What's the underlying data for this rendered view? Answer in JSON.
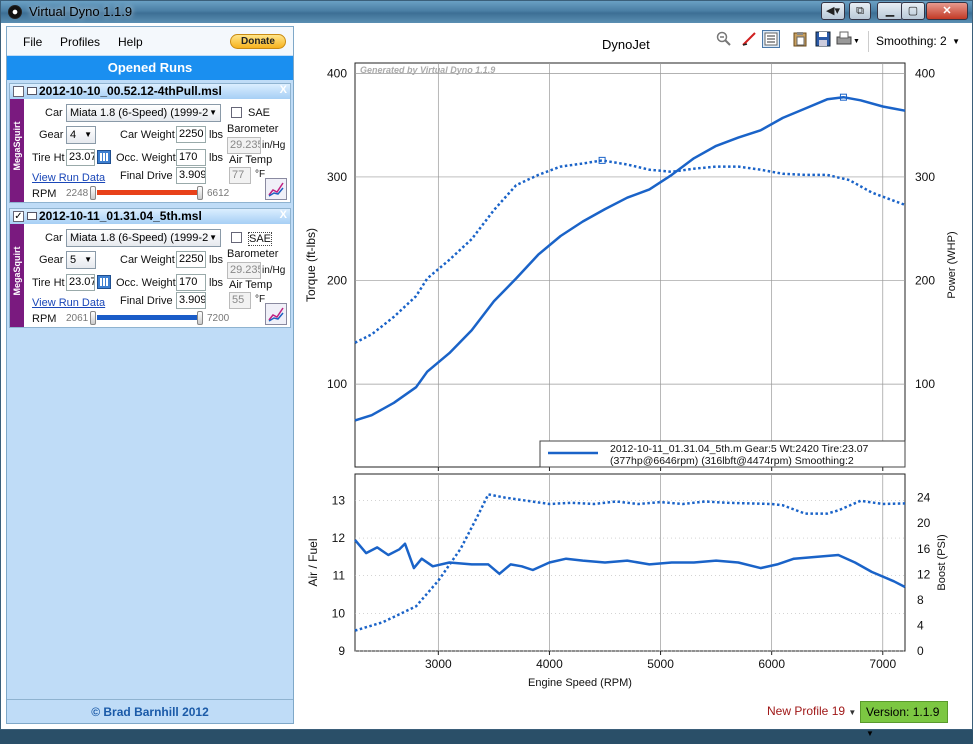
{
  "window": {
    "title": "Virtual Dyno 1.1.9"
  },
  "menu": {
    "file": "File",
    "profiles": "Profiles",
    "help": "Help",
    "donate": "Donate"
  },
  "opened_runs_label": "Opened Runs",
  "runs": [
    {
      "name": "2012-10-10_00.52.12-4thPull.msl",
      "checked": false,
      "ecu": "MegaSquirt",
      "car_label": "Car",
      "car": "Miata 1.8 (6-Speed) (1999-2",
      "sae_label": "SAE",
      "gear_label": "Gear",
      "gear": "4",
      "car_weight_label": "Car Weight",
      "car_weight": "2250",
      "car_weight_unit": "lbs",
      "barometer_label": "Barometer",
      "barometer": "29.235",
      "barometer_unit": "in/Hg",
      "tire_label": "Tire Ht",
      "tire": "23.07",
      "occ_weight_label": "Occ. Weight",
      "occ_weight": "170",
      "occ_weight_unit": "lbs",
      "air_temp_label": "Air Temp",
      "air_temp": "77",
      "air_temp_unit": "°F",
      "view_run": "View Run Data",
      "final_drive_label": "Final Drive",
      "final_drive": "3.909",
      "rpm_label": "RPM",
      "rpm_min": "2248",
      "rpm_max": "6612",
      "slider_color": "#e8411a"
    },
    {
      "name": "2012-10-11_01.31.04_5th.msl",
      "checked": true,
      "ecu": "MegaSquirt",
      "car_label": "Car",
      "car": "Miata 1.8 (6-Speed) (1999-2",
      "sae_label": "SAE",
      "gear_label": "Gear",
      "gear": "5",
      "car_weight_label": "Car Weight",
      "car_weight": "2250",
      "car_weight_unit": "lbs",
      "barometer_label": "Barometer",
      "barometer": "29.235",
      "barometer_unit": "in/Hg",
      "tire_label": "Tire Ht",
      "tire": "23.07",
      "occ_weight_label": "Occ. Weight",
      "occ_weight": "170",
      "occ_weight_unit": "lbs",
      "air_temp_label": "Air Temp",
      "air_temp": "55",
      "air_temp_unit": "°F",
      "view_run": "View Run Data",
      "final_drive_label": "Final Drive",
      "final_drive": "3.909",
      "rpm_label": "RPM",
      "rpm_min": "2061",
      "rpm_max": "7200",
      "slider_color": "#1a5cc8"
    }
  ],
  "footer": {
    "copyright": "© Brad Barnhill 2012"
  },
  "toolbar": {
    "smoothing": "Smoothing: 2"
  },
  "status": {
    "profile": "New Profile 19",
    "version": "Version: 1.1.9"
  },
  "chart_data": [
    {
      "type": "line",
      "title": "DynoJet",
      "watermark": "Generated by Virtual Dyno 1.1.9",
      "xlabel": "Engine Speed (RPM)",
      "ylabel_left": "Torque (ft-lbs)",
      "ylabel_right": "Power (WHP)",
      "xlim": [
        2250,
        7200
      ],
      "ylim": [
        20,
        410
      ],
      "yticks": [
        100,
        200,
        300,
        400
      ],
      "xticks": [
        3000,
        4000,
        5000,
        6000,
        7000
      ],
      "line_color": "#1a63c8",
      "legend": {
        "line1": "2012-10-11_01.31.04_5th.m Gear:5 Wt:2420 Tire:23.07",
        "line2": "(377hp@6646rpm) (316lbft@4474rpm) Smoothing:2"
      },
      "series": [
        {
          "name": "Power (WHP)",
          "style": "solid",
          "x": [
            2250,
            2400,
            2600,
            2800,
            2900,
            3100,
            3300,
            3500,
            3700,
            3900,
            4100,
            4300,
            4500,
            4700,
            4900,
            5100,
            5300,
            5500,
            5700,
            5900,
            6100,
            6300,
            6500,
            6646,
            6800,
            7000,
            7200
          ],
          "y": [
            65,
            70,
            82,
            97,
            112,
            130,
            152,
            180,
            202,
            225,
            243,
            257,
            269,
            280,
            288,
            302,
            318,
            330,
            338,
            345,
            357,
            366,
            375,
            377,
            374,
            368,
            364
          ]
        },
        {
          "name": "Torque (ft-lbs)",
          "style": "dotted",
          "x": [
            2250,
            2400,
            2600,
            2800,
            2900,
            3100,
            3300,
            3500,
            3700,
            3900,
            4100,
            4300,
            4474,
            4700,
            4900,
            5100,
            5300,
            5500,
            5700,
            5900,
            6100,
            6300,
            6500,
            6700,
            6900,
            7200
          ],
          "y": [
            140,
            148,
            165,
            185,
            202,
            220,
            240,
            268,
            292,
            302,
            310,
            313,
            316,
            312,
            307,
            305,
            308,
            310,
            310,
            307,
            303,
            302,
            302,
            297,
            285,
            273
          ]
        }
      ],
      "markers": [
        {
          "x": 4474,
          "y": 316
        },
        {
          "x": 6646,
          "y": 377
        }
      ]
    },
    {
      "type": "line",
      "xlabel": "Engine Speed (RPM)",
      "ylabel_left": "Air / Fuel",
      "ylabel_right": "Boost (PSI)",
      "xlim": [
        2250,
        7200
      ],
      "ylim_left": [
        9,
        13.7
      ],
      "ylim_right": [
        0,
        27.7
      ],
      "yticks_left": [
        9,
        10,
        11,
        12,
        13
      ],
      "yticks_right": [
        0,
        4,
        8,
        12,
        16,
        20,
        24
      ],
      "xticks": [
        3000,
        4000,
        5000,
        6000,
        7000
      ],
      "series": [
        {
          "name": "Air / Fuel",
          "style": "solid",
          "axis": "left",
          "x": [
            2250,
            2350,
            2450,
            2550,
            2650,
            2700,
            2780,
            2850,
            2950,
            3100,
            3300,
            3450,
            3550,
            3650,
            3750,
            3850,
            4000,
            4150,
            4300,
            4500,
            4700,
            4900,
            5100,
            5300,
            5500,
            5700,
            5900,
            6050,
            6200,
            6400,
            6600,
            6750,
            6900,
            7100,
            7200
          ],
          "y": [
            11.95,
            11.6,
            11.75,
            11.55,
            11.7,
            11.85,
            11.2,
            11.45,
            11.25,
            11.35,
            11.3,
            11.3,
            11.05,
            11.3,
            11.25,
            11.15,
            11.35,
            11.45,
            11.4,
            11.35,
            11.4,
            11.3,
            11.35,
            11.35,
            11.4,
            11.35,
            11.2,
            11.3,
            11.45,
            11.5,
            11.55,
            11.35,
            11.1,
            10.85,
            10.7
          ]
        },
        {
          "name": "Boost (PSI)",
          "style": "dotted",
          "axis": "right",
          "x": [
            2250,
            2500,
            2800,
            3000,
            3200,
            3350,
            3450,
            3600,
            3800,
            4000,
            4200,
            4400,
            4600,
            4800,
            5000,
            5200,
            5400,
            5600,
            5800,
            6000,
            6100,
            6300,
            6500,
            6600,
            6800,
            7000,
            7200
          ],
          "y": [
            3.2,
            4.5,
            7,
            11,
            16,
            21,
            24.5,
            24,
            23.5,
            23,
            23.2,
            23,
            23.4,
            23,
            23.3,
            23,
            23.4,
            23.2,
            23.1,
            23,
            22.8,
            21.5,
            21.5,
            22,
            23.5,
            23,
            23.1
          ]
        }
      ]
    }
  ]
}
